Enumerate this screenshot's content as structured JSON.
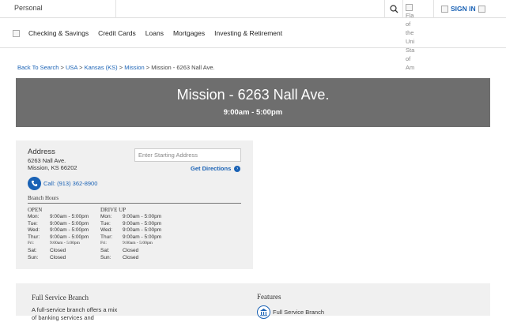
{
  "topbar": {
    "personal_label": "Personal",
    "flag_alt": "Flag of the United States of America",
    "flag_lines": [
      "Fla",
      "of",
      "the",
      "Uni",
      "Sta",
      "of",
      "Am"
    ],
    "signin_label": "SIGN IN"
  },
  "nav": {
    "items": [
      "Checking & Savings",
      "Credit Cards",
      "Loans",
      "Mortgages",
      "Investing & Retirement"
    ]
  },
  "breadcrumb": {
    "links": [
      "Back To Search",
      "USA",
      "Kansas (KS)",
      "Mission"
    ],
    "current": "Mission - 6263 Nall Ave.",
    "separator": ">"
  },
  "banner": {
    "title": "Mission - 6263 Nall Ave.",
    "hours": "9:00am - 5:00pm",
    "background": "#6e6e6e"
  },
  "branch": {
    "address_heading": "Address",
    "street": "6263 Nall Ave.",
    "city_line": "Mission, KS 66202",
    "start_placeholder": "Enter Starting Address",
    "directions_label": "Get Directions",
    "call_label": "Call: (913) 362-8900",
    "hours_label": "Branch Hours",
    "open_heading": "OPEN",
    "drive_heading": "DRIVE UP",
    "open_hours": [
      {
        "day": "Mon:",
        "time": "9:00am - 5:00pm"
      },
      {
        "day": "Tue:",
        "time": "9:00am - 5:00pm"
      },
      {
        "day": "Wed:",
        "time": "9:00am - 5:00pm"
      },
      {
        "day": "Thur:",
        "time": "9:00am - 5:00pm"
      },
      {
        "day": "Fri:",
        "time": "9:00am - 5:00pm"
      },
      {
        "day": "Sat:",
        "time": "Closed"
      },
      {
        "day": "Sun:",
        "time": "Closed"
      }
    ],
    "drive_hours": [
      {
        "day": "Mon:",
        "time": "9:00am - 5:00pm"
      },
      {
        "day": "Tue:",
        "time": "9:00am - 5:00pm"
      },
      {
        "day": "Wed:",
        "time": "9:00am - 5:00pm"
      },
      {
        "day": "Thur:",
        "time": "9:00am - 5:00pm"
      },
      {
        "day": "Fri:",
        "time": "9:00am - 5:00pm"
      },
      {
        "day": "Sat:",
        "time": "Closed"
      },
      {
        "day": "Sun:",
        "time": "Closed"
      }
    ]
  },
  "service": {
    "title": "Full Service Branch",
    "description": "A full-service branch offers a mix",
    "description_cont": "of banking services and",
    "features_title": "Features",
    "feature_item": "Full Service Branch"
  },
  "colors": {
    "link": "#1a62b5",
    "panel": "#f0f0f0"
  }
}
